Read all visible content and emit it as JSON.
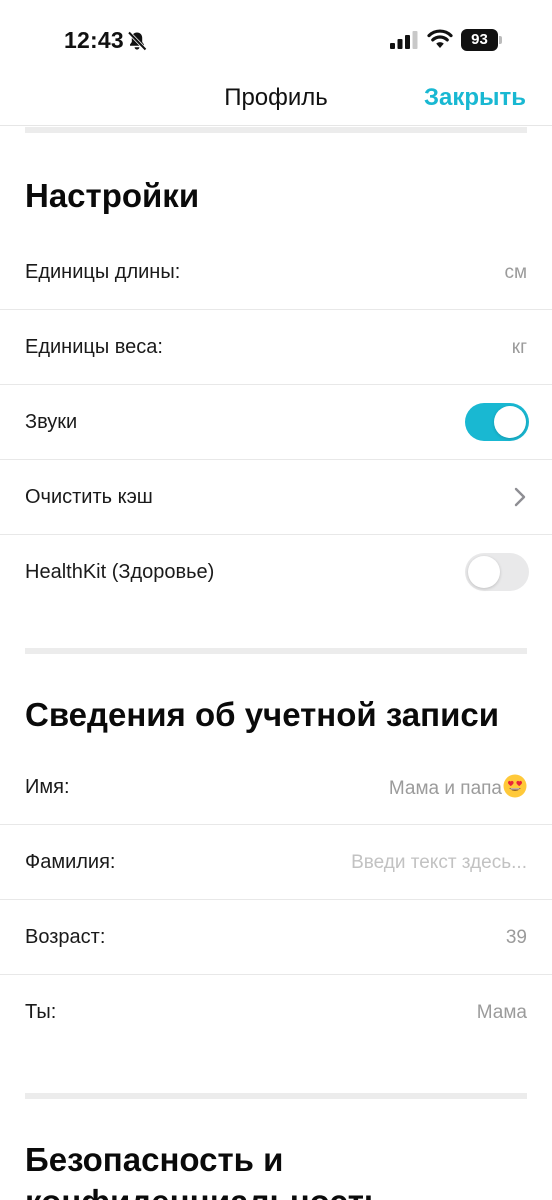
{
  "status_bar": {
    "time": "12:43",
    "battery": "93",
    "icons": [
      "bell-slash-icon",
      "signal-icon",
      "wifi-icon",
      "battery-icon"
    ]
  },
  "nav": {
    "title": "Профиль",
    "close_label": "Закрыть",
    "accent_color": "#19b8d2"
  },
  "settings": {
    "title": "Настройки",
    "length_units": {
      "label": "Единицы длины:",
      "value": "см"
    },
    "weight_units": {
      "label": "Единицы веса:",
      "value": "кг"
    },
    "sounds": {
      "label": "Звуки",
      "enabled": true
    },
    "clear_cache": {
      "label": "Очистить кэш",
      "icon": "chevron-right-icon"
    },
    "healthkit": {
      "label": "HealthKit (Здоровье)",
      "enabled": false
    }
  },
  "account": {
    "title": "Сведения об учетной записи",
    "first_name": {
      "label": "Имя:",
      "value": "Мама и папа",
      "emoji": "heart-eyes-emoji"
    },
    "last_name": {
      "label": "Фамилия:",
      "placeholder": "Введи текст здесь..."
    },
    "age": {
      "label": "Возраст:",
      "value": "39"
    },
    "you": {
      "label": "Ты:",
      "value": "Мама"
    }
  },
  "security": {
    "title": "Безопасность и конфиденциальность"
  }
}
